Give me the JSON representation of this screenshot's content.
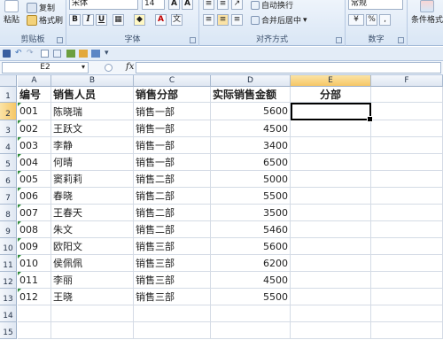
{
  "ribbon": {
    "clipboard": {
      "paste_label": "粘贴",
      "copy_label": "复制",
      "format_painter_label": "格式刷",
      "group_label": "剪贴板"
    },
    "font": {
      "font_name": "宋体",
      "font_size": "14",
      "bold_label": "B",
      "italic_label": "I",
      "underline_label": "U",
      "group_label": "字体"
    },
    "alignment": {
      "wrap_label": "自动换行",
      "merge_label": "合并后居中",
      "group_label": "对齐方式"
    },
    "number": {
      "format_value": "常规",
      "percent_label": "%",
      "comma_label": ",",
      "group_label": "数字"
    },
    "styles": {
      "conditional_label": "条件格式"
    }
  },
  "formula_bar": {
    "name_box": "E2",
    "fx_label": "fx",
    "formula": ""
  },
  "sheet": {
    "columns": [
      "A",
      "B",
      "C",
      "D",
      "E",
      "F"
    ],
    "rows": [
      "1",
      "2",
      "3",
      "4",
      "5",
      "6",
      "7",
      "8",
      "9",
      "10",
      "11",
      "12",
      "13",
      "14",
      "15"
    ],
    "header": {
      "a": "编号",
      "b": "销售人员",
      "c": "销售分部",
      "d": "实际销售金额",
      "e": "分部"
    },
    "data": [
      {
        "a": "001",
        "b": "陈晓瑞",
        "c": "销售一部",
        "d": "5600"
      },
      {
        "a": "002",
        "b": "王跃文",
        "c": "销售一部",
        "d": "4500"
      },
      {
        "a": "003",
        "b": "李静",
        "c": "销售一部",
        "d": "3400"
      },
      {
        "a": "004",
        "b": "何晴",
        "c": "销售一部",
        "d": "6500"
      },
      {
        "a": "005",
        "b": "窦莉莉",
        "c": "销售二部",
        "d": "5000"
      },
      {
        "a": "006",
        "b": "春晓",
        "c": "销售二部",
        "d": "5500"
      },
      {
        "a": "007",
        "b": "王春天",
        "c": "销售二部",
        "d": "3500"
      },
      {
        "a": "008",
        "b": "朱文",
        "c": "销售二部",
        "d": "5460"
      },
      {
        "a": "009",
        "b": "欧阳文",
        "c": "销售三部",
        "d": "5600"
      },
      {
        "a": "010",
        "b": "侯佩佩",
        "c": "销售三部",
        "d": "6200"
      },
      {
        "a": "011",
        "b": "李丽",
        "c": "销售三部",
        "d": "4500"
      },
      {
        "a": "012",
        "b": "王晓",
        "c": "销售三部",
        "d": "5500"
      }
    ]
  },
  "colors": {
    "selection_header": "#f6c766",
    "error_indicator": "#2e8b3a",
    "ribbon_bg": "#d9e6f5"
  }
}
